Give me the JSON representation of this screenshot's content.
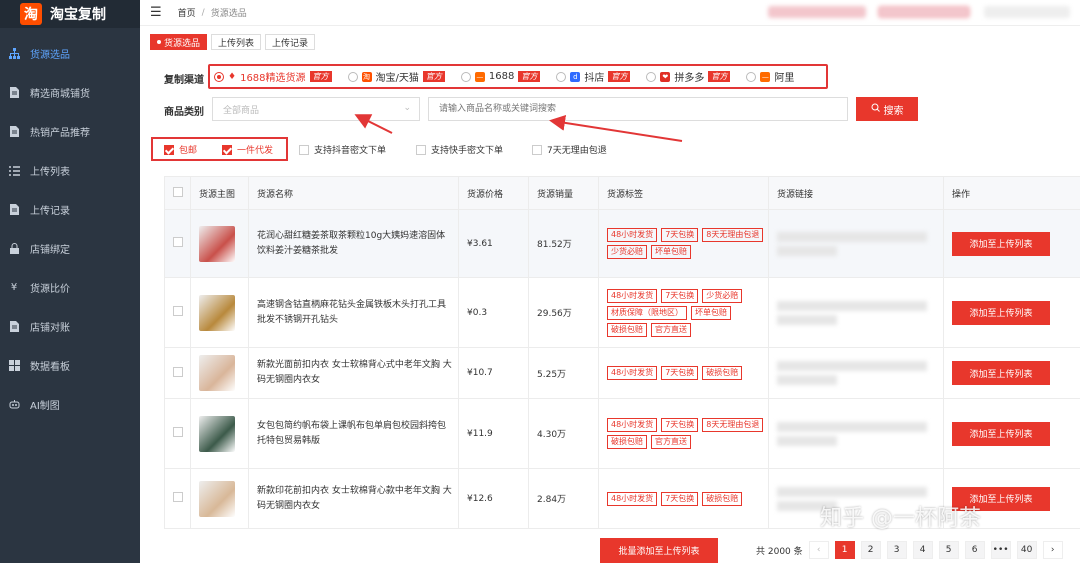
{
  "app": {
    "logo_char": "淘",
    "title": "淘宝复制"
  },
  "sidebar": {
    "items": [
      {
        "label": "货源选品",
        "icon": "sitemap-icon",
        "active": true
      },
      {
        "label": "精选商城铺货",
        "icon": "document-icon",
        "active": false
      },
      {
        "label": "热销产品推荐",
        "icon": "document-icon",
        "active": false
      },
      {
        "label": "上传列表",
        "icon": "list-icon",
        "active": false
      },
      {
        "label": "上传记录",
        "icon": "document-icon",
        "active": false
      },
      {
        "label": "店铺绑定",
        "icon": "lock-icon",
        "active": false
      },
      {
        "label": "货源比价",
        "icon": "yen-icon",
        "active": false
      },
      {
        "label": "店铺对账",
        "icon": "document-icon",
        "active": false
      },
      {
        "label": "数据看板",
        "icon": "grid-icon",
        "active": false
      },
      {
        "label": "AI制图",
        "icon": "robot-icon",
        "active": false
      }
    ]
  },
  "breadcrumb": {
    "home": "首页",
    "separator": "/",
    "current": "货源选品"
  },
  "tabs": [
    "货源选品",
    "上传列表",
    "上传记录"
  ],
  "filters": {
    "channel_label": "复制渠道",
    "channels": [
      {
        "label": "1688精选货源",
        "official": "官方",
        "checked": true,
        "icon_color": "#e8372c"
      },
      {
        "label": "淘宝/天猫",
        "official": "官方",
        "checked": false,
        "icon_color": "#ff5000"
      },
      {
        "label": "1688",
        "official": "官方",
        "checked": false,
        "icon_color": "#ff6a00"
      },
      {
        "label": "抖店",
        "official": "官方",
        "checked": false,
        "icon_color": "#2f6bff"
      },
      {
        "label": "拼多多",
        "official": "官方",
        "checked": false,
        "icon_color": "#e02e24"
      },
      {
        "label": "阿里",
        "official": "",
        "checked": false,
        "icon_color": "#ff6a00"
      }
    ],
    "category_label": "商品类别",
    "category_placeholder": "全部商品",
    "search_placeholder": "请输入商品名称或关键词搜索",
    "search_button": "搜索",
    "checkboxes": [
      {
        "label": "包邮",
        "checked": true
      },
      {
        "label": "一件代发",
        "checked": true
      },
      {
        "label": "支持抖音密文下单",
        "checked": false
      },
      {
        "label": "支持快手密文下单",
        "checked": false
      },
      {
        "label": "7天无理由包退",
        "checked": false
      }
    ]
  },
  "table": {
    "headers": [
      "货源主图",
      "货源名称",
      "货源价格",
      "货源销量",
      "货源标签",
      "货源链接",
      "操作"
    ],
    "action_label": "添加至上传列表",
    "rows": [
      {
        "name": "花润心甜红糖姜茶取茶颗粒10g大姨妈速溶固体饮料姜汁姜糖茶批发",
        "price": "¥3.61",
        "sales": "81.52万",
        "tags": [
          "48小时发货",
          "7天包换",
          "8天无理由包退",
          "少货必赔",
          "坏单包赔"
        ],
        "thumb_color": "#c9504a"
      },
      {
        "name": "高速钢含钴直柄麻花钻头金属铁板木头打孔工具批发不锈钢开孔钻头",
        "price": "¥0.3",
        "sales": "29.56万",
        "tags": [
          "48小时发货",
          "7天包换",
          "少货必赔",
          "材质保障（限地区）",
          "坏单包赔",
          "破损包赔",
          "官方直送"
        ],
        "thumb_color": "#b8893c"
      },
      {
        "name": "新款光面前扣内衣 女士软棉背心式中老年文胸 大码无钢圈内衣女",
        "price": "¥10.7",
        "sales": "5.25万",
        "tags": [
          "48小时发货",
          "7天包换",
          "破损包赔"
        ],
        "thumb_color": "#d9b59a"
      },
      {
        "name": "女包包简约帆布袋上课帆布包单肩包校园斜挎包托特包贸易韩版",
        "price": "¥11.9",
        "sales": "4.30万",
        "tags": [
          "48小时发货",
          "7天包换",
          "8天无理由包退",
          "破损包赔",
          "官方直送"
        ],
        "thumb_color": "#3c5a4a"
      },
      {
        "name": "新款印花前扣内衣 女士软棉背心款中老年文胸 大码无钢圈内衣女",
        "price": "¥12.6",
        "sales": "2.84万",
        "tags": [
          "48小时发货",
          "7天包换",
          "破损包赔"
        ],
        "thumb_color": "#d8b898"
      }
    ]
  },
  "footer": {
    "batch_button": "批量添加至上传列表",
    "total": "共 2000 条",
    "pages": [
      "1",
      "2",
      "3",
      "4",
      "5",
      "6",
      "•••",
      "40"
    ],
    "prev": "‹",
    "next": "›"
  },
  "watermark": "知乎 @一杯阿茶",
  "colors": {
    "accent": "#e8372c",
    "sidebar_bg": "#2b3541",
    "annotation_red": "#e23636"
  }
}
